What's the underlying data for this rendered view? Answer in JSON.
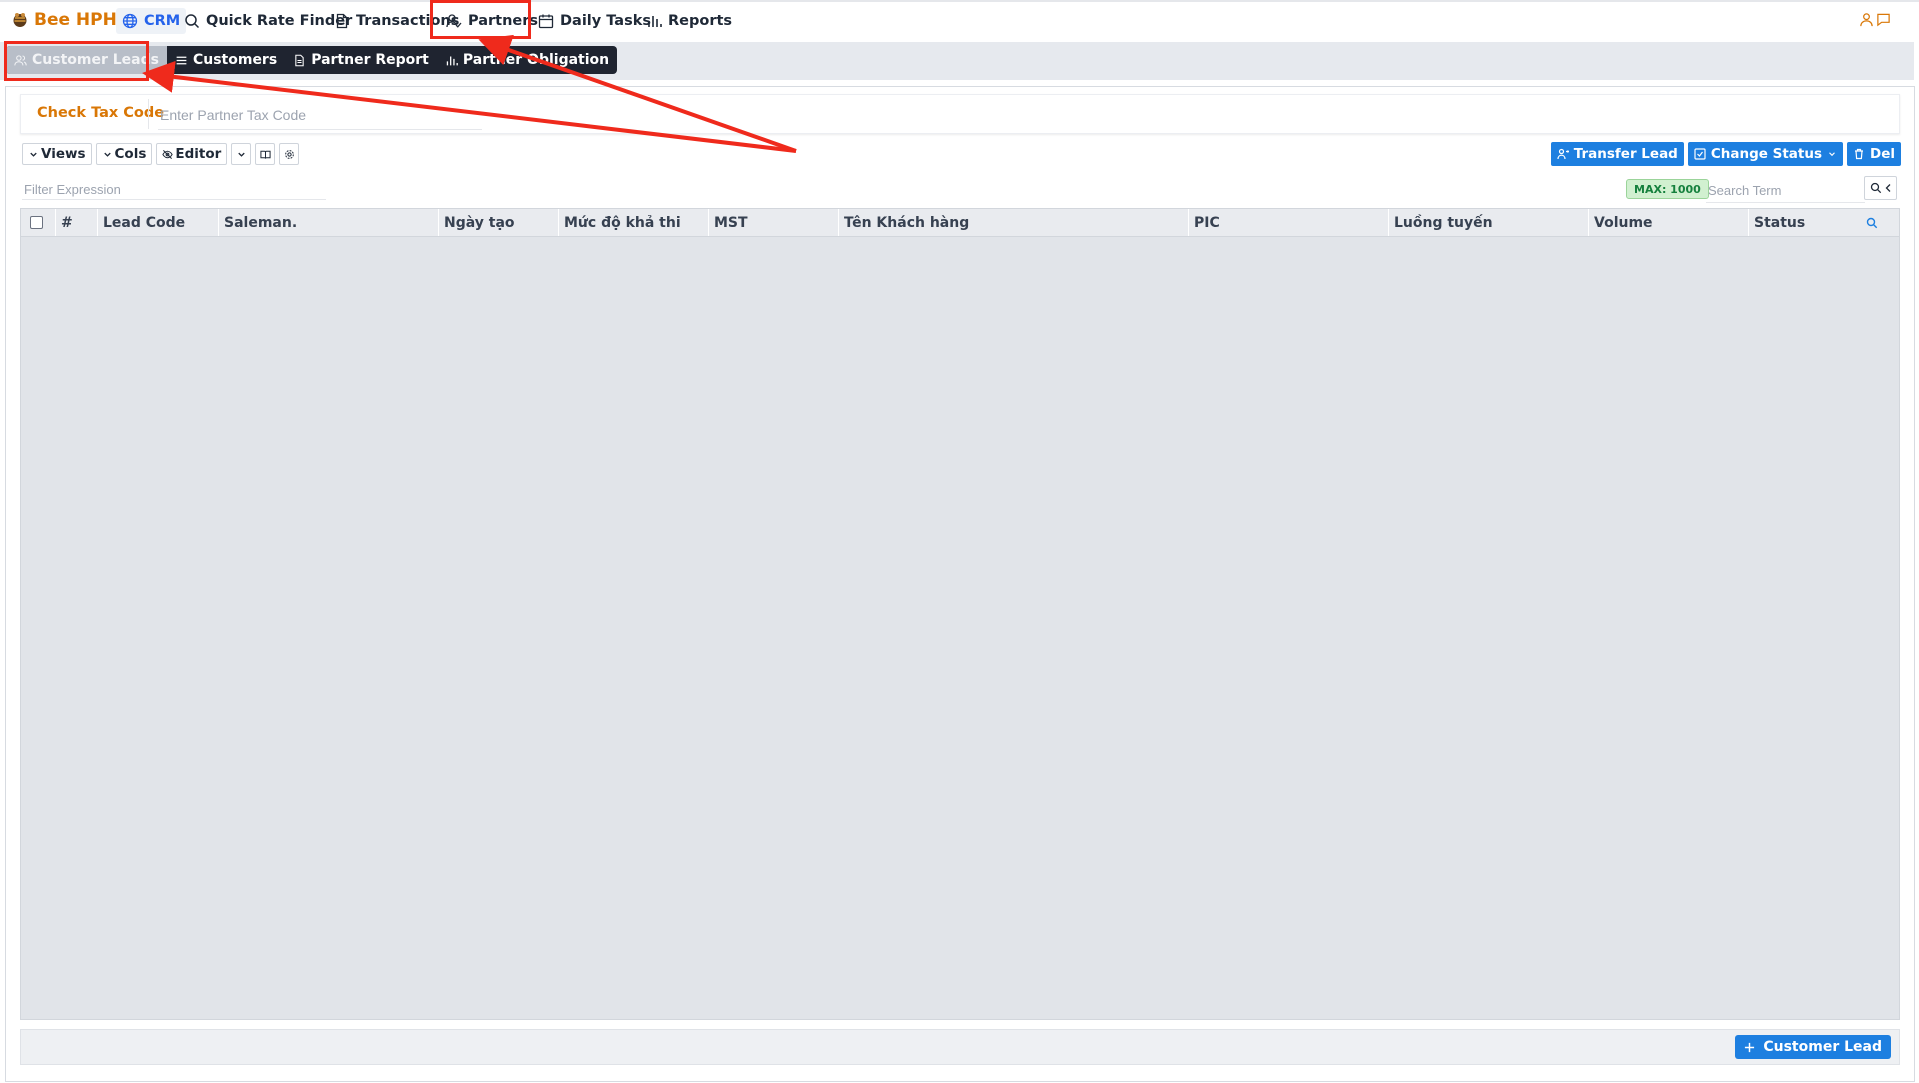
{
  "app": {
    "name": "Bee HPH",
    "modules": [
      {
        "label": "CRM",
        "icon": "globe-icon"
      },
      {
        "label": "Quick Rate Finder",
        "icon": "search-icon"
      },
      {
        "label": "Transactions",
        "icon": "document-icon"
      },
      {
        "label": "Partners",
        "icon": "user-check-icon"
      },
      {
        "label": "Daily Tasks",
        "icon": "calendar-icon"
      },
      {
        "label": "Reports",
        "icon": "bar-chart-icon"
      }
    ],
    "right_icons": [
      "user-icon",
      "chat-icon"
    ]
  },
  "subnav": {
    "tabs": [
      {
        "label": "Customer Leads",
        "icon": "users-icon",
        "active": true
      },
      {
        "label": "Customers",
        "icon": "list-icon"
      },
      {
        "label": "Partner Report",
        "icon": "report-icon"
      },
      {
        "label": "Partner Obligation",
        "icon": "bar-chart-icon"
      }
    ]
  },
  "taxcheck": {
    "label": "Check Tax Code",
    "placeholder": "Enter Partner Tax Code",
    "value": ""
  },
  "toolbar": {
    "views": "Views",
    "cols": "Cols",
    "editor": "Editor"
  },
  "actions": {
    "transfer_lead": "Transfer Lead",
    "change_status": "Change Status",
    "delete": "Del"
  },
  "filter": {
    "placeholder": "Filter Expression",
    "max_badge": "MAX: 1000",
    "search_placeholder": "Search Term"
  },
  "table": {
    "columns": [
      "#",
      "Lead Code",
      "Saleman.",
      "Ngày tạo",
      "Mức độ khả thi",
      "MST",
      "Tên Khách hàng",
      "PIC",
      "Luồng tuyến",
      "Volume",
      "Status"
    ],
    "rows": []
  },
  "footer": {
    "add_button": "Customer Lead"
  },
  "colors": {
    "accent": "#1d7fe0",
    "brand": "#d97706",
    "highlight": "#ef2a1c",
    "subnav_bg": "#1f2430"
  }
}
